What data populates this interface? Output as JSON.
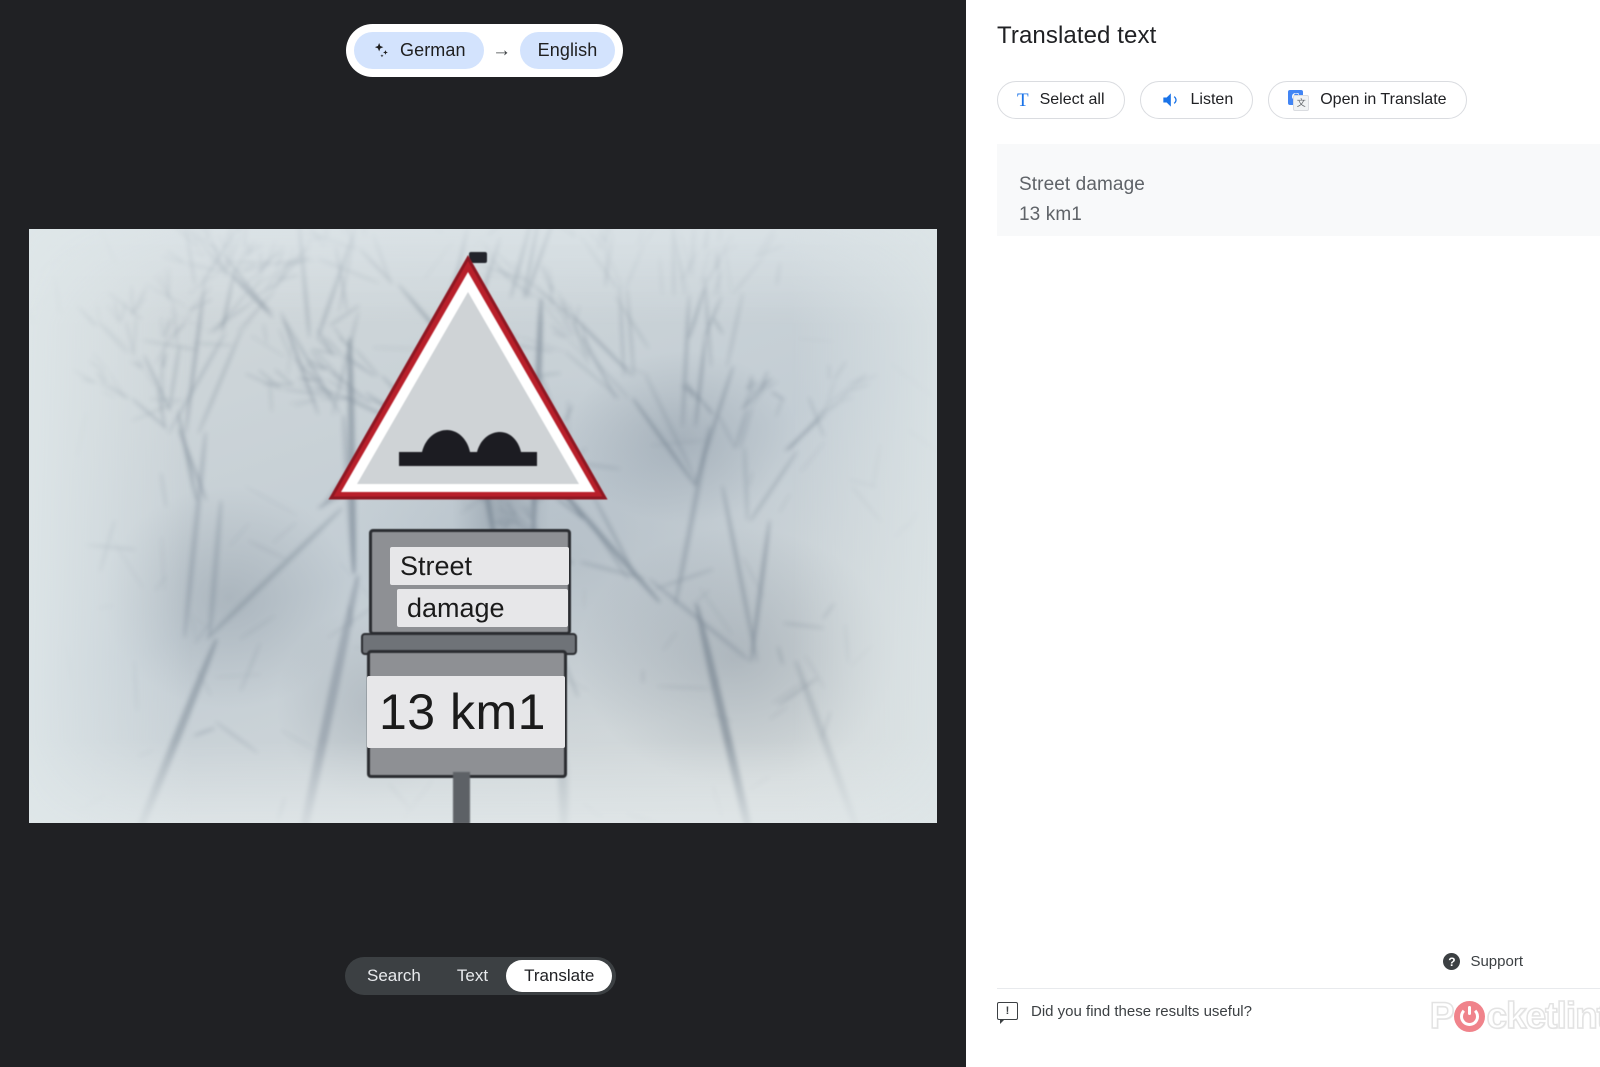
{
  "language_selector": {
    "source_label": "German",
    "source_icon": "sparkle-icon",
    "arrow": "→",
    "target_label": "English"
  },
  "image": {
    "alt": "German road sign: red warning triangle above two rectangular plates",
    "overlay_texts": [
      "Street",
      "damage",
      "13 km1"
    ]
  },
  "mode_tabs": {
    "items": [
      {
        "label": "Search",
        "active": false
      },
      {
        "label": "Text",
        "active": false
      },
      {
        "label": "Translate",
        "active": true
      }
    ]
  },
  "panel": {
    "title": "Translated text",
    "actions": [
      {
        "label": "Select all",
        "icon": "text-select-icon"
      },
      {
        "label": "Listen",
        "icon": "volume-up-icon"
      },
      {
        "label": "Open in Translate",
        "icon": "google-translate-icon"
      }
    ],
    "result": {
      "lines": [
        "Street damage",
        "13 km1"
      ]
    },
    "support_label": "Support",
    "support_icon": "help-circle-icon",
    "feedback_label": "Did you find these results useful?",
    "feedback_icon": "feedback-icon"
  },
  "watermark": {
    "prefix": "P",
    "suffix": "cketlint"
  },
  "colors": {
    "dark_pane": "#202124",
    "chip_blue": "#d3e3fd",
    "accent_blue": "#1a73e8",
    "result_card": "#f8f9fa",
    "watermark_pink": "#f07d85"
  }
}
